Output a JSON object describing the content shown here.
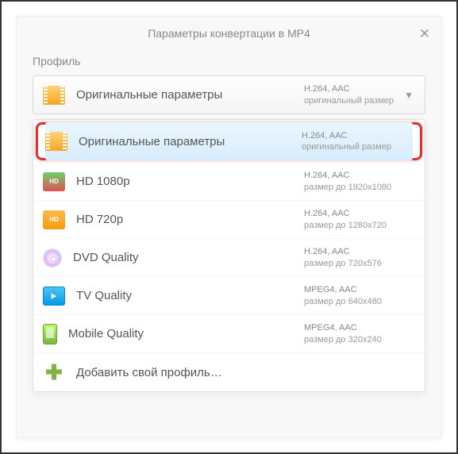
{
  "header": {
    "title": "Параметры конвертации в MP4",
    "close": "✕"
  },
  "profile_label": "Профиль",
  "selector": {
    "name": "Оригинальные параметры",
    "codec": "H.264, AAC",
    "size": "оригинальный размер"
  },
  "options": [
    {
      "name": "Оригинальные параметры",
      "codec": "H.264, AAC",
      "size": "оригинальный размер",
      "icon": "film"
    },
    {
      "name": "HD 1080p",
      "codec": "H.264, AAC",
      "size": "размер до 1920x1080",
      "icon": "hd1080"
    },
    {
      "name": "HD 720p",
      "codec": "H.264, AAC",
      "size": "размер до 1280x720",
      "icon": "hd720"
    },
    {
      "name": "DVD Quality",
      "codec": "H.264, AAC",
      "size": "размер до 720x576",
      "icon": "dvd"
    },
    {
      "name": "TV Quality",
      "codec": "MPEG4, AAC",
      "size": "размер до 640x480",
      "icon": "tv"
    },
    {
      "name": "Mobile Quality",
      "codec": "MPEG4, AAC",
      "size": "размер до 320x240",
      "icon": "mobile"
    },
    {
      "name": "Добавить свой профиль…",
      "codec": "",
      "size": "",
      "icon": "plus"
    }
  ],
  "badges": {
    "hd": "HD"
  }
}
